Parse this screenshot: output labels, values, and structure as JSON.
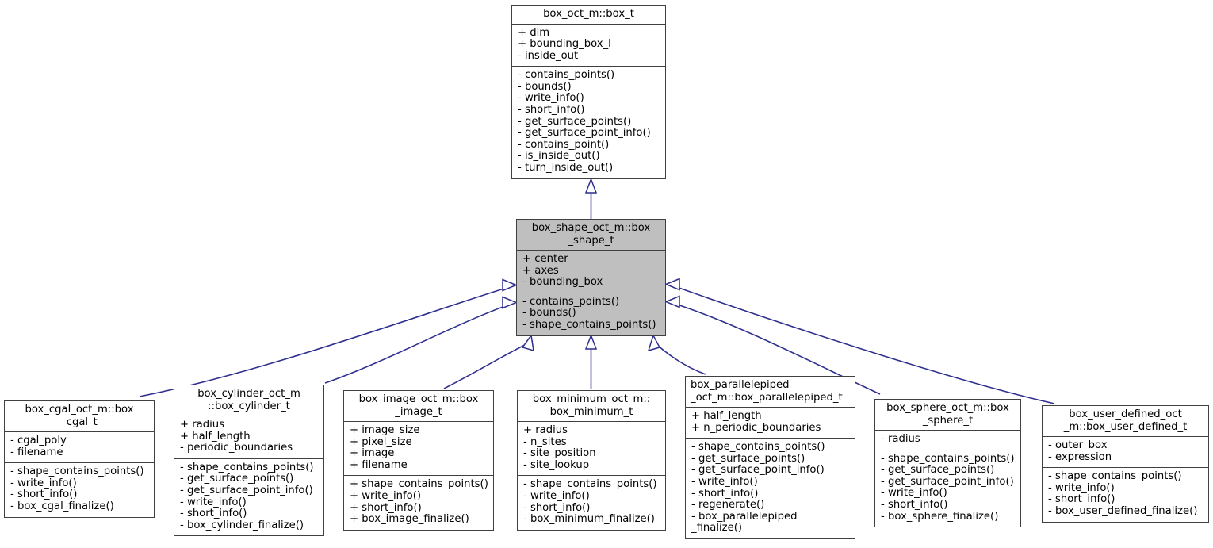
{
  "diagram": {
    "type": "uml-class-inheritance",
    "title_text": "",
    "edge_color": "#2f2f8f",
    "highlight_color": "#bfbfbf",
    "border_color": "#404040",
    "background_color": "#ffffff"
  },
  "classes": {
    "box_t": {
      "name": "box_oct_m::box_t",
      "attributes": [
        "+ dim",
        "+ bounding_box_l",
        "- inside_out"
      ],
      "methods": [
        "- contains_points()",
        "- bounds()",
        "- write_info()",
        "- short_info()",
        "- get_surface_points()",
        "- get_surface_point_info()",
        "- contains_point()",
        "- is_inside_out()",
        "- turn_inside_out()"
      ]
    },
    "box_shape_t": {
      "name": "box_shape_oct_m::box\n_shape_t",
      "attributes": [
        "+ center",
        "+ axes",
        "- bounding_box"
      ],
      "methods": [
        "- contains_points()",
        "- bounds()",
        "- shape_contains_points()"
      ]
    },
    "box_cgal_t": {
      "name": "box_cgal_oct_m::box\n_cgal_t",
      "attributes": [
        "- cgal_poly",
        "- filename"
      ],
      "methods": [
        "- shape_contains_points()",
        "- write_info()",
        "- short_info()",
        "- box_cgal_finalize()"
      ]
    },
    "box_cylinder_t": {
      "name": "box_cylinder_oct_m\n::box_cylinder_t",
      "attributes": [
        "+ radius",
        "+ half_length",
        "- periodic_boundaries"
      ],
      "methods": [
        "- shape_contains_points()",
        "- get_surface_points()",
        "- get_surface_point_info()",
        "- write_info()",
        "- short_info()",
        "- box_cylinder_finalize()"
      ]
    },
    "box_image_t": {
      "name": "box_image_oct_m::box\n_image_t",
      "attributes": [
        "+ image_size",
        "+ pixel_size",
        "+ image",
        "+ filename"
      ],
      "methods": [
        "+ shape_contains_points()",
        "+ write_info()",
        "+ short_info()",
        "+ box_image_finalize()"
      ]
    },
    "box_minimum_t": {
      "name": "box_minimum_oct_m::\nbox_minimum_t",
      "attributes": [
        "+ radius",
        "- n_sites",
        "- site_position",
        "- site_lookup"
      ],
      "methods": [
        "- shape_contains_points()",
        "- write_info()",
        "- short_info()",
        "- box_minimum_finalize()"
      ]
    },
    "box_parallelepiped_t": {
      "name": "box_parallelepiped\n_oct_m::box_parallelepiped_t",
      "attributes": [
        "+ half_length",
        "+ n_periodic_boundaries"
      ],
      "methods": [
        "- shape_contains_points()",
        "- get_surface_points()",
        "- get_surface_point_info()",
        "- write_info()",
        "- short_info()",
        "- regenerate()",
        "- box_parallelepiped\n_finalize()"
      ]
    },
    "box_sphere_t": {
      "name": "box_sphere_oct_m::box\n_sphere_t",
      "attributes": [
        "- radius"
      ],
      "methods": [
        "- shape_contains_points()",
        "- get_surface_points()",
        "- get_surface_point_info()",
        "- write_info()",
        "- short_info()",
        "- box_sphere_finalize()"
      ]
    },
    "box_user_defined_t": {
      "name": "box_user_defined_oct\n_m::box_user_defined_t",
      "attributes": [
        "- outer_box",
        "- expression"
      ],
      "methods": [
        "- shape_contains_points()",
        "- write_info()",
        "- short_info()",
        "- box_user_defined_finalize()"
      ]
    }
  },
  "inheritance_edges": [
    {
      "from": "box_shape_t",
      "to": "box_t"
    },
    {
      "from": "box_cgal_t",
      "to": "box_shape_t"
    },
    {
      "from": "box_cylinder_t",
      "to": "box_shape_t"
    },
    {
      "from": "box_image_t",
      "to": "box_shape_t"
    },
    {
      "from": "box_minimum_t",
      "to": "box_shape_t"
    },
    {
      "from": "box_parallelepiped_t",
      "to": "box_shape_t"
    },
    {
      "from": "box_sphere_t",
      "to": "box_shape_t"
    },
    {
      "from": "box_user_defined_t",
      "to": "box_shape_t"
    }
  ]
}
